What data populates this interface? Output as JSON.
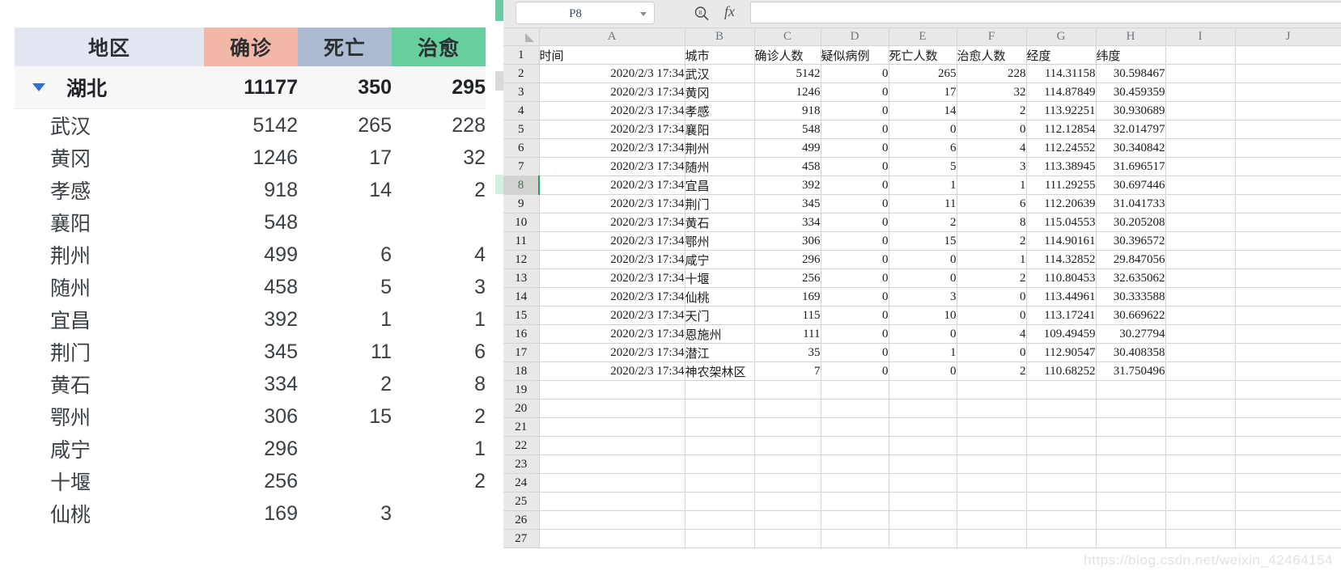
{
  "summary_panel": {
    "headers": {
      "region": "地区",
      "confirmed": "确诊",
      "death": "死亡",
      "cured": "治愈"
    },
    "header_colors": {
      "region_bg": "#e2e7f2",
      "confirmed_bg": "#f2b7a6",
      "death_bg": "#adbbd2",
      "cured_bg": "#67ce9e"
    },
    "total_row": {
      "name": "湖北",
      "confirmed": "11177",
      "death": "350",
      "cured": "295",
      "expanded": true
    },
    "cities": [
      {
        "name": "武汉",
        "confirmed": "5142",
        "death": "265",
        "cured": "228"
      },
      {
        "name": "黄冈",
        "confirmed": "1246",
        "death": "17",
        "cured": "32"
      },
      {
        "name": "孝感",
        "confirmed": "918",
        "death": "14",
        "cured": "2"
      },
      {
        "name": "襄阳",
        "confirmed": "548",
        "death": "",
        "cured": ""
      },
      {
        "name": "荆州",
        "confirmed": "499",
        "death": "6",
        "cured": "4"
      },
      {
        "name": "随州",
        "confirmed": "458",
        "death": "5",
        "cured": "3"
      },
      {
        "name": "宜昌",
        "confirmed": "392",
        "death": "1",
        "cured": "1"
      },
      {
        "name": "荆门",
        "confirmed": "345",
        "death": "11",
        "cured": "6"
      },
      {
        "name": "黄石",
        "confirmed": "334",
        "death": "2",
        "cured": "8"
      },
      {
        "name": "鄂州",
        "confirmed": "306",
        "death": "15",
        "cured": "2"
      },
      {
        "name": "咸宁",
        "confirmed": "296",
        "death": "",
        "cured": "1"
      },
      {
        "name": "十堰",
        "confirmed": "256",
        "death": "",
        "cured": "2"
      },
      {
        "name": "仙桃",
        "confirmed": "169",
        "death": "3",
        "cured": ""
      }
    ]
  },
  "spreadsheet": {
    "toolbar": {
      "name_box_value": "P8",
      "fx_label": "fx",
      "formula_value": ""
    },
    "column_headers": [
      "A",
      "B",
      "C",
      "D",
      "E",
      "F",
      "G",
      "H",
      "I",
      "J"
    ],
    "selected_cell_row": "8",
    "header_row": {
      "row_number": "1",
      "cells": [
        "时间",
        "城市",
        "确诊人数",
        "疑似病例",
        "死亡人数",
        "治愈人数",
        "经度",
        "纬度",
        "",
        ""
      ]
    },
    "rows": [
      {
        "n": "2",
        "time": "2020/2/3 17:34",
        "city": "武汉",
        "confirmed": "5142",
        "suspected": "0",
        "death": "265",
        "cured": "228",
        "lng": "114.31158",
        "lat": "30.598467"
      },
      {
        "n": "3",
        "time": "2020/2/3 17:34",
        "city": "黄冈",
        "confirmed": "1246",
        "suspected": "0",
        "death": "17",
        "cured": "32",
        "lng": "114.87849",
        "lat": "30.459359"
      },
      {
        "n": "4",
        "time": "2020/2/3 17:34",
        "city": "孝感",
        "confirmed": "918",
        "suspected": "0",
        "death": "14",
        "cured": "2",
        "lng": "113.92251",
        "lat": "30.930689"
      },
      {
        "n": "5",
        "time": "2020/2/3 17:34",
        "city": "襄阳",
        "confirmed": "548",
        "suspected": "0",
        "death": "0",
        "cured": "0",
        "lng": "112.12854",
        "lat": "32.014797"
      },
      {
        "n": "6",
        "time": "2020/2/3 17:34",
        "city": "荆州",
        "confirmed": "499",
        "suspected": "0",
        "death": "6",
        "cured": "4",
        "lng": "112.24552",
        "lat": "30.340842"
      },
      {
        "n": "7",
        "time": "2020/2/3 17:34",
        "city": "随州",
        "confirmed": "458",
        "suspected": "0",
        "death": "5",
        "cured": "3",
        "lng": "113.38945",
        "lat": "31.696517"
      },
      {
        "n": "8",
        "time": "2020/2/3 17:34",
        "city": "宜昌",
        "confirmed": "392",
        "suspected": "0",
        "death": "1",
        "cured": "1",
        "lng": "111.29255",
        "lat": "30.697446"
      },
      {
        "n": "9",
        "time": "2020/2/3 17:34",
        "city": "荆门",
        "confirmed": "345",
        "suspected": "0",
        "death": "11",
        "cured": "6",
        "lng": "112.20639",
        "lat": "31.041733"
      },
      {
        "n": "10",
        "time": "2020/2/3 17:34",
        "city": "黄石",
        "confirmed": "334",
        "suspected": "0",
        "death": "2",
        "cured": "8",
        "lng": "115.04553",
        "lat": "30.205208"
      },
      {
        "n": "11",
        "time": "2020/2/3 17:34",
        "city": "鄂州",
        "confirmed": "306",
        "suspected": "0",
        "death": "15",
        "cured": "2",
        "lng": "114.90161",
        "lat": "30.396572"
      },
      {
        "n": "12",
        "time": "2020/2/3 17:34",
        "city": "咸宁",
        "confirmed": "296",
        "suspected": "0",
        "death": "0",
        "cured": "1",
        "lng": "114.32852",
        "lat": "29.847056"
      },
      {
        "n": "13",
        "time": "2020/2/3 17:34",
        "city": "十堰",
        "confirmed": "256",
        "suspected": "0",
        "death": "0",
        "cured": "2",
        "lng": "110.80453",
        "lat": "32.635062"
      },
      {
        "n": "14",
        "time": "2020/2/3 17:34",
        "city": "仙桃",
        "confirmed": "169",
        "suspected": "0",
        "death": "3",
        "cured": "0",
        "lng": "113.44961",
        "lat": "30.333588"
      },
      {
        "n": "15",
        "time": "2020/2/3 17:34",
        "city": "天门",
        "confirmed": "115",
        "suspected": "0",
        "death": "10",
        "cured": "0",
        "lng": "113.17241",
        "lat": "30.669622"
      },
      {
        "n": "16",
        "time": "2020/2/3 17:34",
        "city": "恩施州",
        "confirmed": "111",
        "suspected": "0",
        "death": "0",
        "cured": "4",
        "lng": "109.49459",
        "lat": "30.27794"
      },
      {
        "n": "17",
        "time": "2020/2/3 17:34",
        "city": "潜江",
        "confirmed": "35",
        "suspected": "0",
        "death": "1",
        "cured": "0",
        "lng": "112.90547",
        "lat": "30.408358"
      },
      {
        "n": "18",
        "time": "2020/2/3 17:34",
        "city": "神农架林区",
        "confirmed": "7",
        "suspected": "0",
        "death": "0",
        "cured": "2",
        "lng": "110.68252",
        "lat": "31.750496"
      }
    ],
    "empty_row_numbers": [
      "19",
      "20",
      "21",
      "22",
      "23",
      "24",
      "25",
      "26",
      "27"
    ],
    "watermark": "https://blog.csdn.net/weixin_42464154"
  }
}
